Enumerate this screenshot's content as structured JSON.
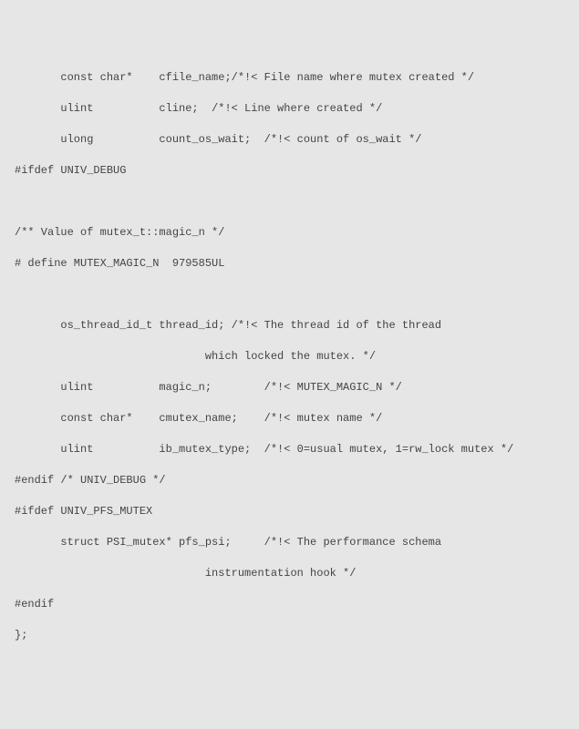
{
  "code": {
    "lines": [
      "       const char*    cfile_name;/*!< File name where mutex created */",
      "",
      "       ulint          cline;  /*!< Line where created */",
      "",
      "       ulong          count_os_wait;  /*!< count of os_wait */",
      "",
      "#ifdef UNIV_DEBUG",
      "",
      "",
      "",
      "/** Value of mutex_t::magic_n */",
      "",
      "# define MUTEX_MAGIC_N  979585UL",
      "",
      "",
      "",
      "       os_thread_id_t thread_id; /*!< The thread id of the thread",
      "",
      "                             which locked the mutex. */",
      "",
      "       ulint          magic_n;        /*!< MUTEX_MAGIC_N */",
      "",
      "       const char*    cmutex_name;    /*!< mutex name */",
      "",
      "       ulint          ib_mutex_type;  /*!< 0=usual mutex, 1=rw_lock mutex */",
      "",
      "#endif /* UNIV_DEBUG */",
      "",
      "#ifdef UNIV_PFS_MUTEX",
      "",
      "       struct PSI_mutex* pfs_psi;     /*!< The performance schema",
      "",
      "                             instrumentation hook */",
      "",
      "#endif",
      "",
      "};"
    ]
  }
}
